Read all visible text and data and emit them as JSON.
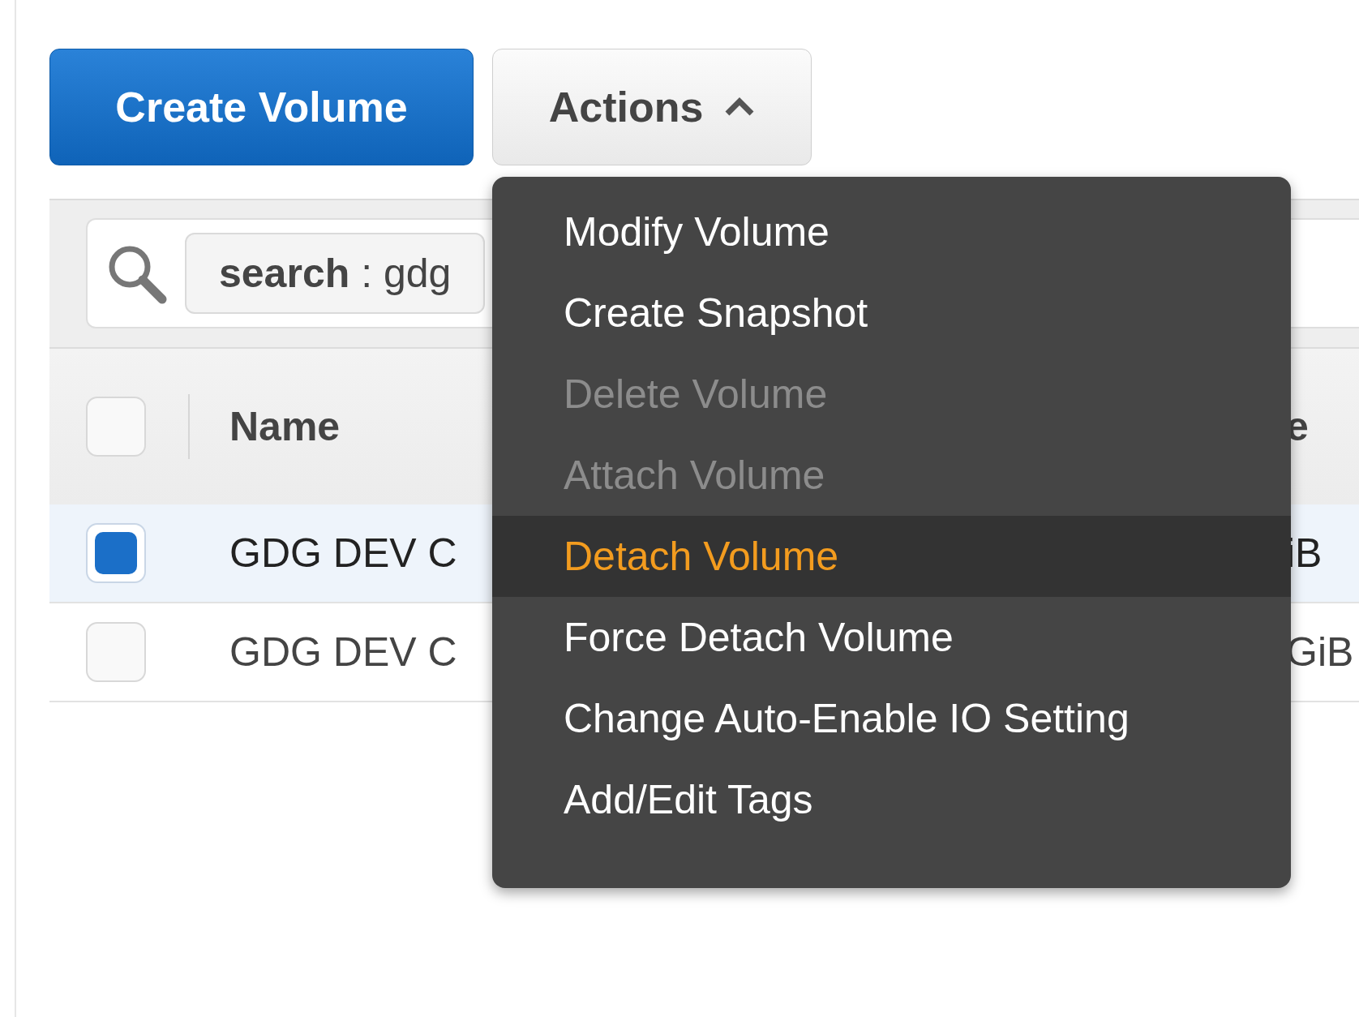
{
  "toolbar": {
    "create_button": "Create Volume",
    "actions_button": {
      "label": "Actions",
      "expanded": true
    }
  },
  "filter": {
    "token": "**search** : gdg"
  },
  "table": {
    "header": {
      "checked": false,
      "columns": [
        "Name",
        "e"
      ]
    },
    "rows": [
      {
        "selected": true,
        "checked": true,
        "cells": [
          "GDG DEV C",
          "iB"
        ]
      },
      {
        "selected": false,
        "checked": false,
        "cells": [
          "GDG DEV C",
          "GiB"
        ]
      }
    ]
  },
  "actions_menu": {
    "items": [
      {
        "label": "Modify Volume",
        "disabled": false,
        "selected": false
      },
      {
        "label": "Create Snapshot",
        "disabled": false,
        "selected": false
      },
      {
        "label": "Delete Volume",
        "disabled": true,
        "selected": false
      },
      {
        "label": "Attach Volume",
        "disabled": true,
        "selected": false
      },
      {
        "label": "Detach Volume",
        "disabled": false,
        "selected": true
      },
      {
        "label": "Force Detach Volume",
        "disabled": false,
        "selected": false
      },
      {
        "label": "Change Auto-Enable IO Setting",
        "disabled": false,
        "selected": false
      },
      {
        "label": "Add/Edit Tags",
        "disabled": false,
        "selected": false
      }
    ]
  }
}
